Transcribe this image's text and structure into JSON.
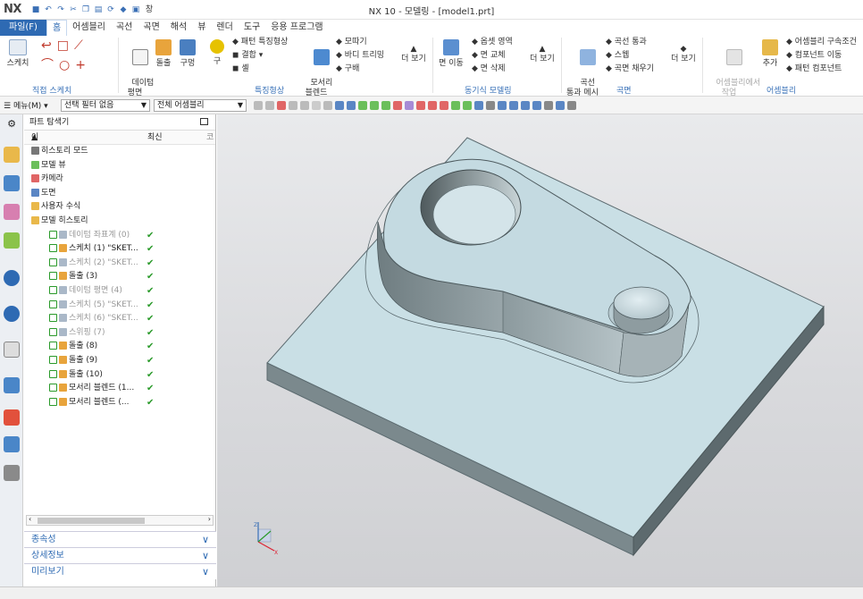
{
  "app": {
    "logo": "NX",
    "window_title": "NX 10 - 모델링 - [model1.prt]",
    "qat_window_label": "창"
  },
  "menu": {
    "items": [
      "파일(F)",
      "홈",
      "어셈블리",
      "곡선",
      "곡면",
      "해석",
      "뷰",
      "렌더",
      "도구",
      "응용 프로그램"
    ]
  },
  "ribbon": {
    "sketch": "스케치",
    "datum_plane": "데이텀\n평면",
    "extrude": "돌출",
    "hole": "구멍",
    "sphere": "구",
    "pattern_feature": "패턴 특징형상",
    "combine": "결합",
    "shell": "셸",
    "edge_blend": "모서리\n블렌드",
    "chamfer": "모따기",
    "trim_body": "바디 트리밍",
    "draft": "구배",
    "more1": "더 보기",
    "move_face": "면 이동",
    "offset_region": "옵셋 영역",
    "replace_face": "면 교체",
    "delete_face": "면 삭제",
    "more2": "더 보기",
    "curve_mesh": "곡선\n통과 메시",
    "through_curves": "곡선 통과",
    "swept": "스웹",
    "fill_surface": "곡면 채우기",
    "more3": "더 보기",
    "assembly_work": "어셈블리에서\n작업",
    "add": "추가",
    "assembly_constraint": "어셈블리 구속조건",
    "move_component": "컴포넌트 이동",
    "pattern_component": "패턴 컴포넌트",
    "groups": {
      "direct_sketch": "직접 스케치",
      "feature": "특징형상",
      "sync": "동기식 모델링",
      "surface": "곡면",
      "assembly": "어셈블리"
    }
  },
  "toolbar": {
    "menu_label": "메뉴(M)",
    "filter": "선택 필터 없음",
    "scope": "전체 어셈블리"
  },
  "navigator": {
    "title": "파트 탐색기",
    "columns": {
      "name": "이름",
      "latest": "최신",
      "third": "코"
    },
    "nodes": [
      {
        "label": "히스토리 모드",
        "indent": 0,
        "gray": false,
        "check": ""
      },
      {
        "label": "모델 뷰",
        "indent": 0,
        "gray": false,
        "check": ""
      },
      {
        "label": "카메라",
        "indent": 0,
        "gray": false,
        "check": ""
      },
      {
        "label": "도면",
        "indent": 0,
        "gray": false,
        "check": ""
      },
      {
        "label": "사용자 수식",
        "indent": 0,
        "gray": false,
        "check": ""
      },
      {
        "label": "모델 히스토리",
        "indent": 0,
        "gray": false,
        "check": ""
      },
      {
        "label": "데이텀 좌표계 (0)",
        "indent": 1,
        "gray": true,
        "check": "✔"
      },
      {
        "label": "스케치 (1) \"SKET...",
        "indent": 1,
        "gray": false,
        "check": "✔"
      },
      {
        "label": "스케치 (2) \"SKET...",
        "indent": 1,
        "gray": true,
        "check": "✔"
      },
      {
        "label": "돌출 (3)",
        "indent": 1,
        "gray": false,
        "check": "✔"
      },
      {
        "label": "데이텀 평면 (4)",
        "indent": 1,
        "gray": true,
        "check": "✔"
      },
      {
        "label": "스케치 (5) \"SKET...",
        "indent": 1,
        "gray": true,
        "check": "✔"
      },
      {
        "label": "스케치 (6) \"SKET...",
        "indent": 1,
        "gray": true,
        "check": "✔"
      },
      {
        "label": "스위핑 (7)",
        "indent": 1,
        "gray": true,
        "check": "✔"
      },
      {
        "label": "돌출 (8)",
        "indent": 1,
        "gray": false,
        "check": "✔"
      },
      {
        "label": "돌출 (9)",
        "indent": 1,
        "gray": false,
        "check": "✔"
      },
      {
        "label": "돌출 (10)",
        "indent": 1,
        "gray": false,
        "check": "✔"
      },
      {
        "label": "모서리 블렌드 (1...",
        "indent": 1,
        "gray": false,
        "check": "✔"
      },
      {
        "label": "모서리 블렌드 (...",
        "indent": 1,
        "gray": false,
        "check": "✔"
      }
    ],
    "panels": [
      "종속성",
      "상세정보",
      "미리보기"
    ]
  },
  "colors": {
    "accent": "#2e6ab3",
    "check": "#2a9a2a",
    "plate": "#c9dfe5",
    "wall": "#7d8b8f"
  }
}
